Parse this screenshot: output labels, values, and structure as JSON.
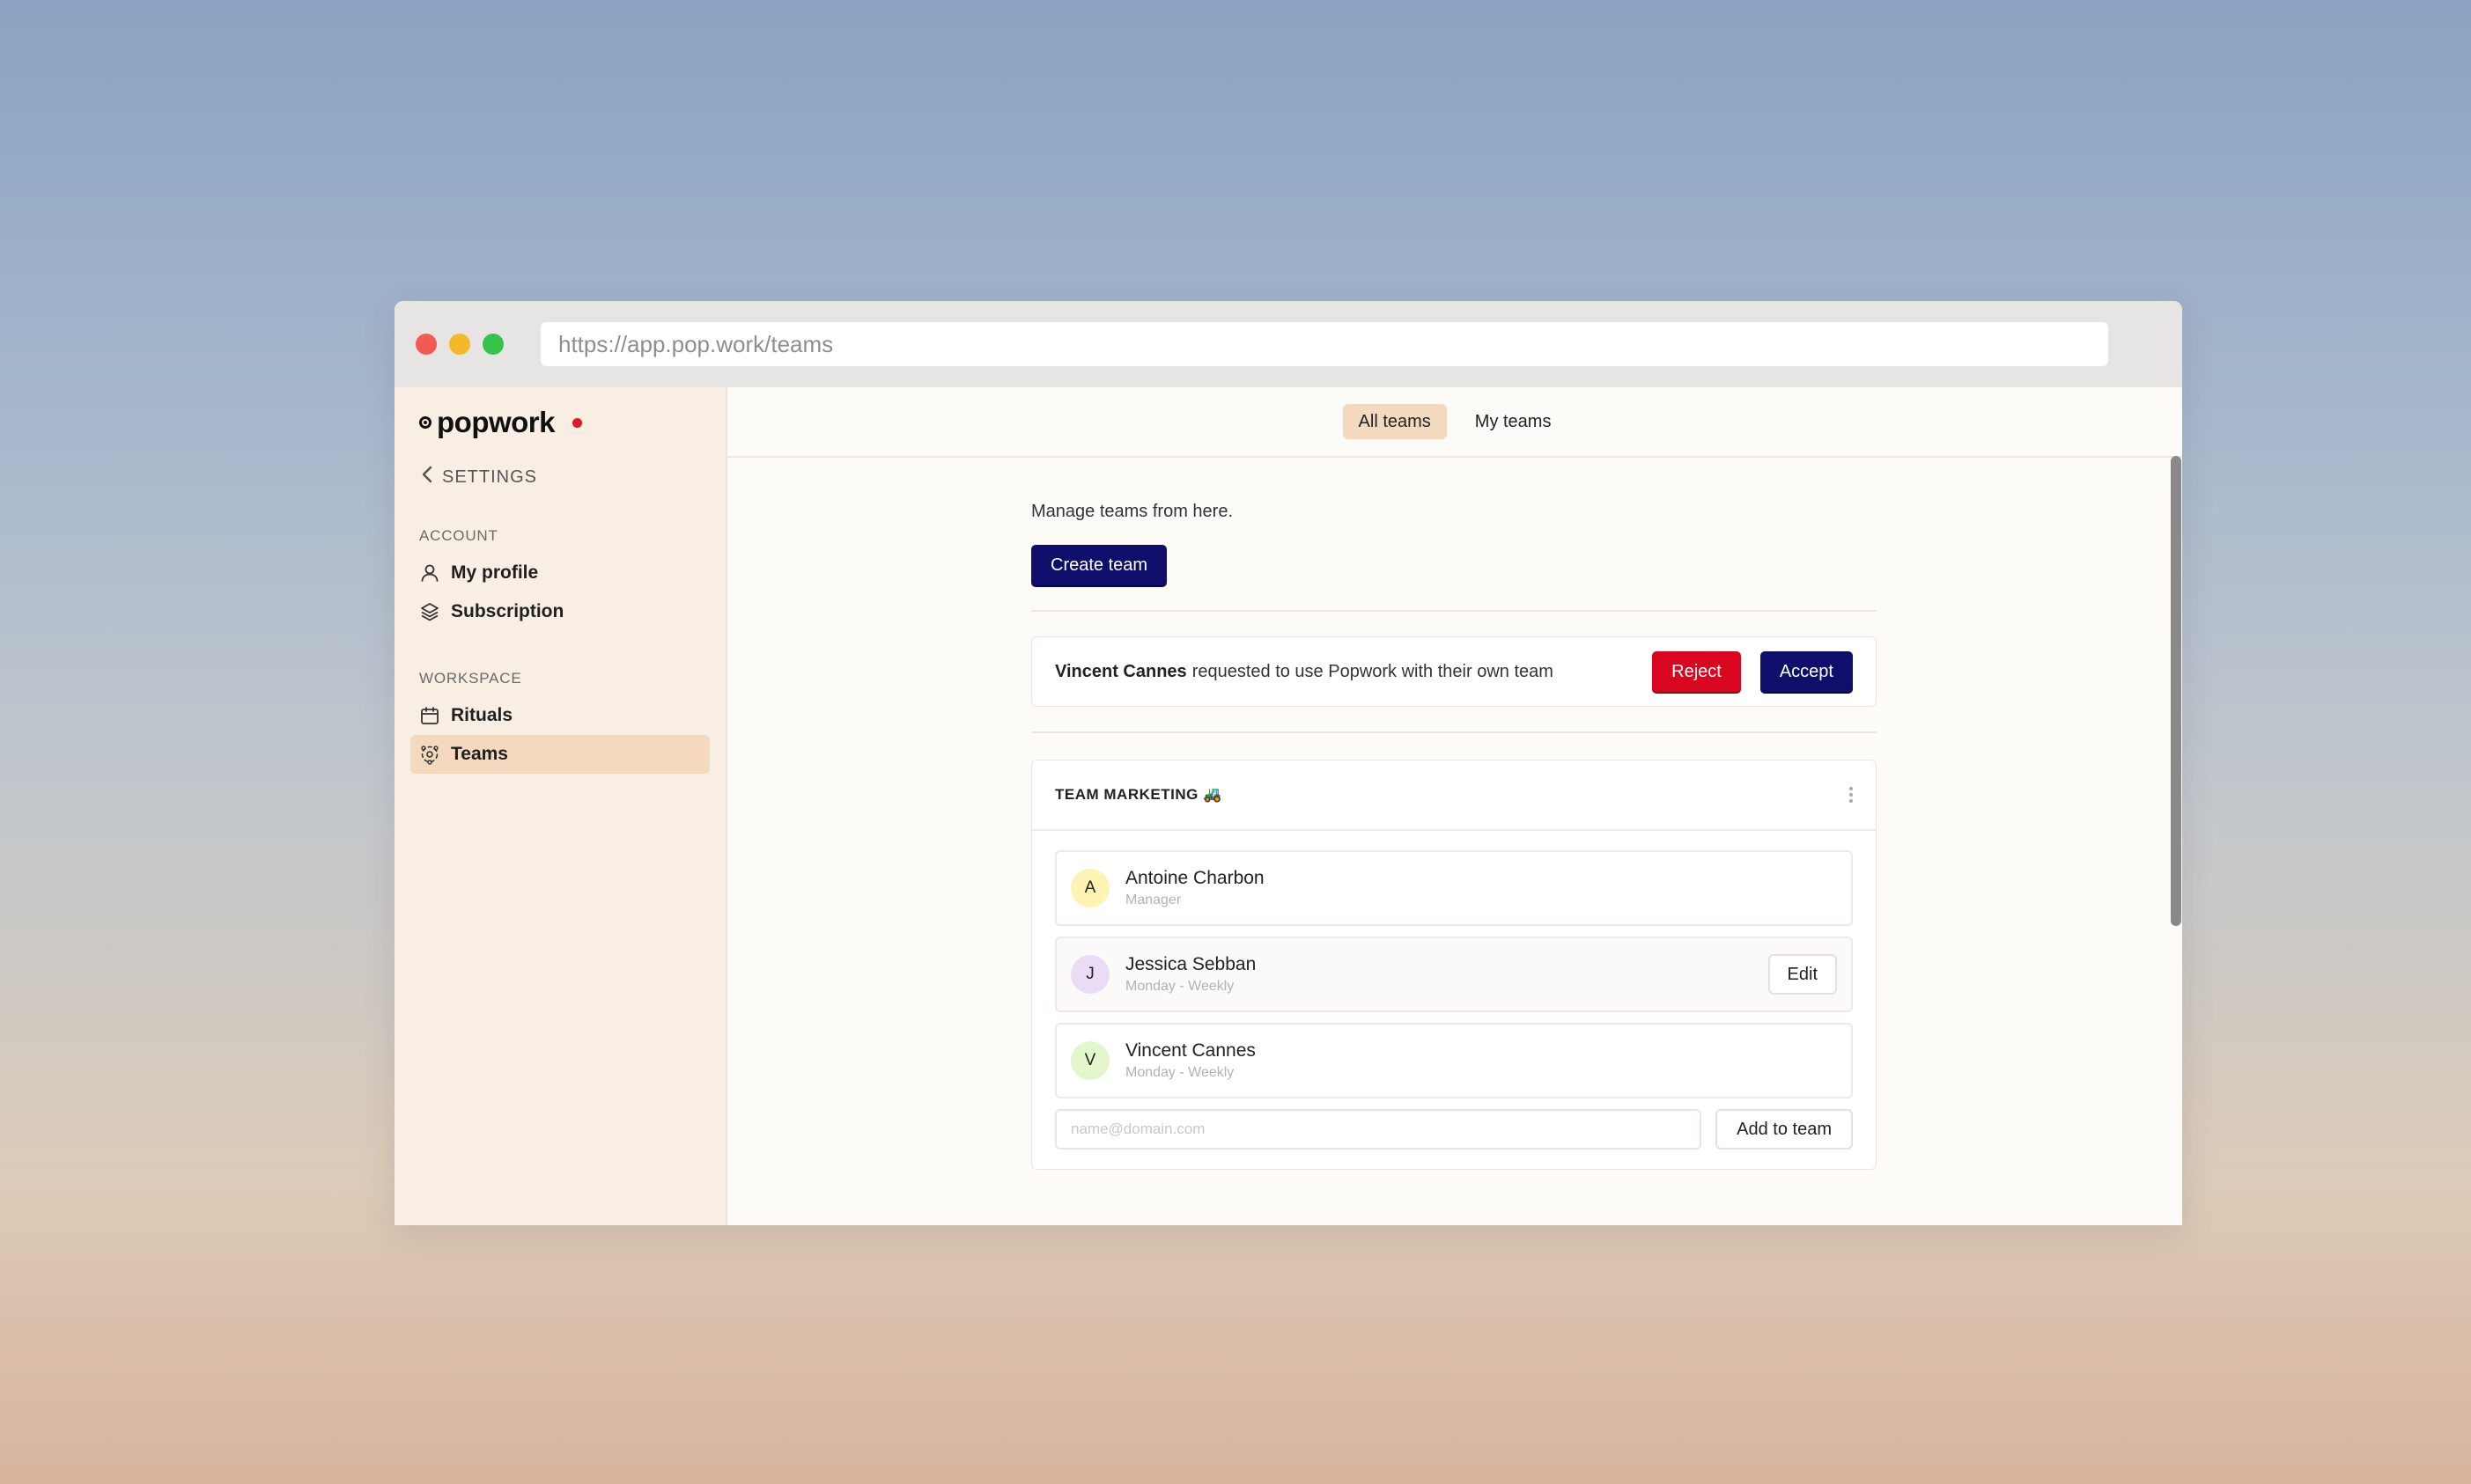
{
  "browser": {
    "url": "https://app.pop.work/teams"
  },
  "sidebar": {
    "logo_text": "popwork",
    "back_label": "SETTINGS",
    "account_label": "ACCOUNT",
    "account_items": [
      {
        "label": "My profile",
        "icon": "user-icon"
      },
      {
        "label": "Subscription",
        "icon": "layers-icon"
      }
    ],
    "workspace_label": "WORKSPACE",
    "workspace_items": [
      {
        "label": "Rituals",
        "icon": "calendar-icon"
      },
      {
        "label": "Teams",
        "icon": "teams-icon",
        "active": true
      }
    ]
  },
  "tabs": [
    {
      "label": "All teams",
      "active": true
    },
    {
      "label": "My teams",
      "active": false
    }
  ],
  "main": {
    "description": "Manage teams from here.",
    "create_button": "Create team"
  },
  "request": {
    "name": "Vincent Cannes",
    "message": "requested to use Popwork with their own team",
    "reject_label": "Reject",
    "accept_label": "Accept"
  },
  "team": {
    "name": "TEAM MARKETING 🚜",
    "members": [
      {
        "initial": "A",
        "name": "Antoine Charbon",
        "sub": "Manager"
      },
      {
        "initial": "J",
        "name": "Jessica Sebban",
        "sub": "Monday - Weekly",
        "action": "Edit"
      },
      {
        "initial": "V",
        "name": "Vincent Cannes",
        "sub": "Monday - Weekly"
      }
    ],
    "email_placeholder": "name@domain.com",
    "add_button": "Add to team"
  },
  "colors": {
    "primary": "#0f0f6b",
    "danger": "#d9061f",
    "accent": "#f4d9be",
    "sidebar_bg": "#f8eee4"
  }
}
